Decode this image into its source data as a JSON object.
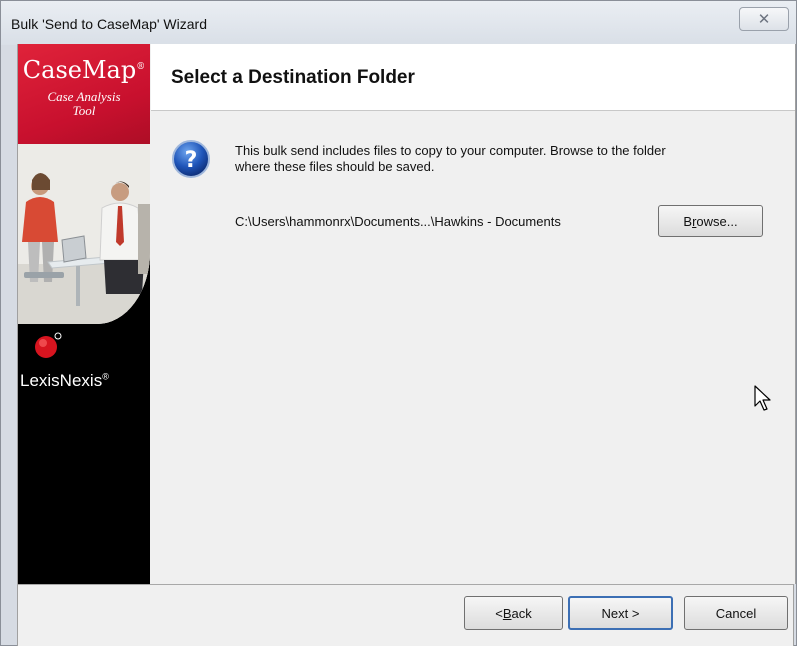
{
  "window": {
    "title": "Bulk 'Send to CaseMap' Wizard",
    "close_glyph": "✕"
  },
  "sidebar": {
    "brand": "CaseMap",
    "brand_mark": "®",
    "tagline_line1": "Case Analysis",
    "tagline_line2": "Tool",
    "vendor": "LexisNexis",
    "vendor_mark": "®",
    "colors": {
      "red": "#c8102e",
      "black": "#000000"
    }
  },
  "main": {
    "title": "Select a Destination Folder",
    "intro_line1": "This bulk send includes files to copy to your computer.  Browse to the folder",
    "intro_line2": "where these files should be saved.",
    "path": "C:\\Users\\hammonrx\\Documents...\\Hawkins - Documents",
    "browse_label_pre": "B",
    "browse_label_u": "r",
    "browse_label_post": "owse..."
  },
  "footer": {
    "back_label_pre": "< ",
    "back_label_u": "B",
    "back_label_post": "ack",
    "next_label": "Next >",
    "cancel_label": "Cancel"
  },
  "icons": {
    "help": "question-circle-icon",
    "cursor": "mouse-pointer-icon",
    "close": "close-icon"
  }
}
